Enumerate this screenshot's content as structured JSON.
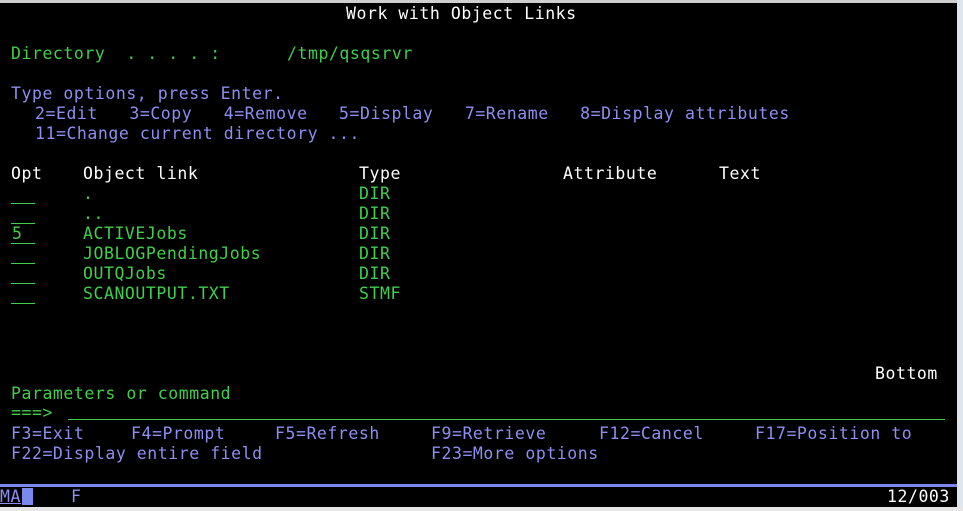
{
  "screen": {
    "title": "Work with Object Links",
    "directory_label": "Directory  . . . . :",
    "directory_value": "/tmp/qsqsrvr",
    "instructions": "Type options, press Enter.",
    "options_line1": "2=Edit   3=Copy   4=Remove   5=Display   7=Rename   8=Display attributes",
    "options_line2": "11=Change current directory ...",
    "columns": {
      "opt": "Opt",
      "object_link": "Object link",
      "type": "Type",
      "attribute": "Attribute",
      "text": "Text"
    },
    "rows": [
      {
        "opt": "",
        "object_link": ".",
        "type": "DIR",
        "attribute": "",
        "text": ""
      },
      {
        "opt": "",
        "object_link": "..",
        "type": "DIR",
        "attribute": "",
        "text": ""
      },
      {
        "opt": "5",
        "object_link": "ACTIVEJobs",
        "type": "DIR",
        "attribute": "",
        "text": ""
      },
      {
        "opt": "",
        "object_link": "JOBLOGPendingJobs",
        "type": "DIR",
        "attribute": "",
        "text": ""
      },
      {
        "opt": "",
        "object_link": "OUTQJobs",
        "type": "DIR",
        "attribute": "",
        "text": ""
      },
      {
        "opt": "",
        "object_link": "SCANOUTPUT.TXT",
        "type": "STMF",
        "attribute": "",
        "text": ""
      }
    ],
    "list_position": "Bottom",
    "parameters_label": "Parameters or command",
    "command_prompt": "===>",
    "command_value": "",
    "function_keys": [
      {
        "key": "F3",
        "label": "F3=Exit"
      },
      {
        "key": "F4",
        "label": "F4=Prompt"
      },
      {
        "key": "F5",
        "label": "F5=Refresh"
      },
      {
        "key": "F9",
        "label": "F9=Retrieve"
      },
      {
        "key": "F12",
        "label": "F12=Cancel"
      },
      {
        "key": "F17",
        "label": "F17=Position to"
      },
      {
        "key": "F22",
        "label": "F22=Display entire field"
      },
      {
        "key": "F23",
        "label": "F23=More options"
      }
    ]
  },
  "status_bar": {
    "mode": "MA",
    "indicator": "F",
    "cursor_position": "12/003"
  },
  "colors": {
    "background": "#000000",
    "heading": "#ffffff",
    "field": "#3fcf4a",
    "help_text": "#8c8ff0",
    "status_line": "#7a88f0"
  }
}
